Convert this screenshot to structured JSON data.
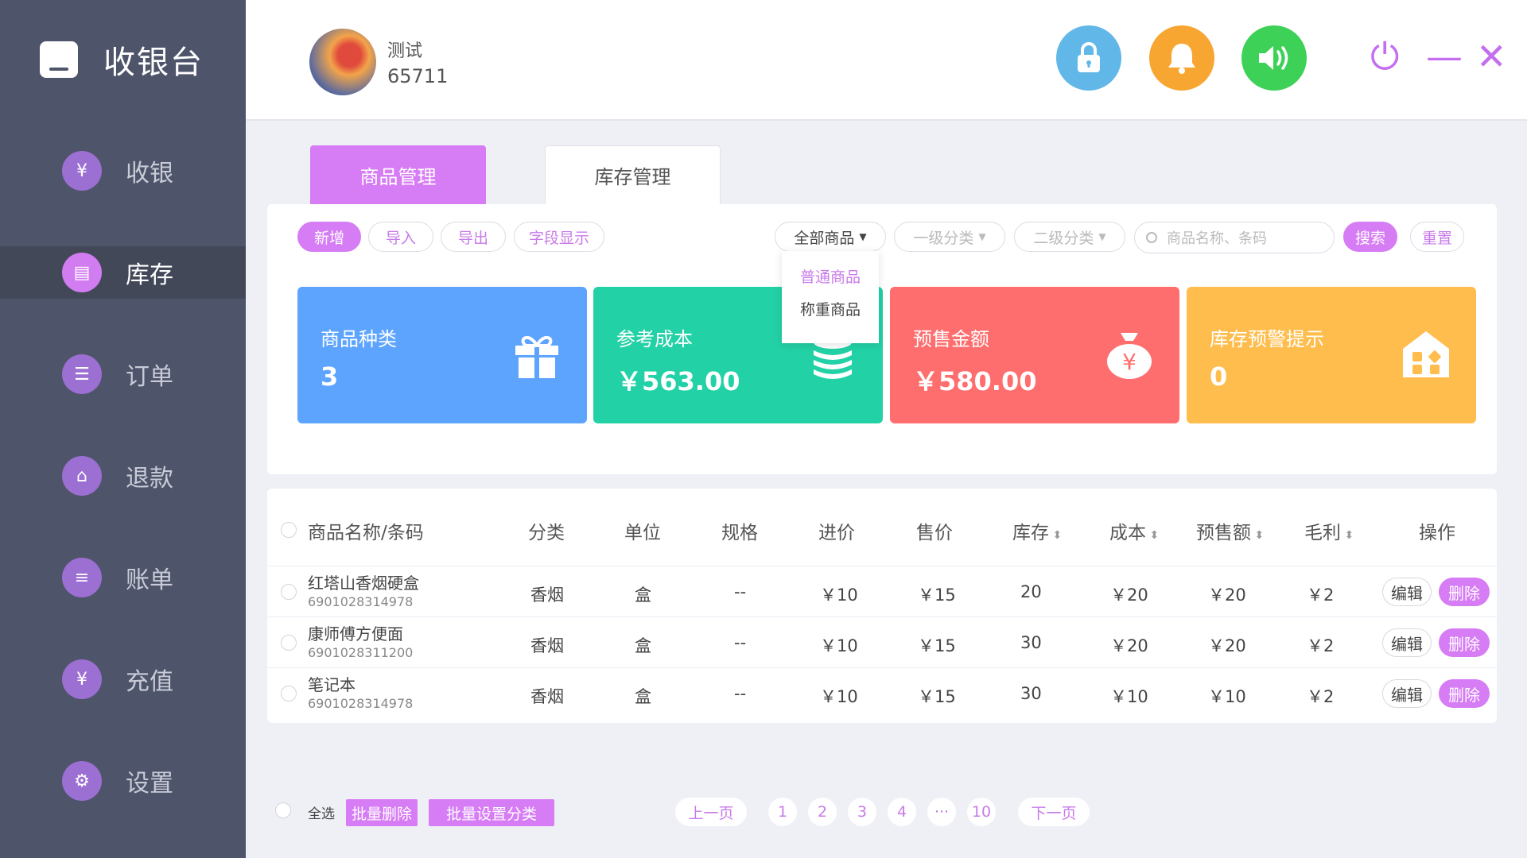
{
  "app": {
    "title": "收银台"
  },
  "sidebar": {
    "items": [
      {
        "label": "收银",
        "icon": "¥"
      },
      {
        "label": "库存",
        "icon": "▤"
      },
      {
        "label": "订单",
        "icon": "☰"
      },
      {
        "label": "退款",
        "icon": "⌂"
      },
      {
        "label": "账单",
        "icon": "≡"
      },
      {
        "label": "充值",
        "icon": "¥"
      },
      {
        "label": "设置",
        "icon": "⚙"
      }
    ],
    "active": "库存"
  },
  "header": {
    "user_name": "测试",
    "user_id": "65711",
    "lock_icon": "🔒",
    "bell_icon": "🔔",
    "sound_icon": "🔊",
    "power_icon": "⏻",
    "minimize_icon": "—",
    "close_icon": "✕"
  },
  "tabs": [
    {
      "label": "商品管理"
    },
    {
      "label": "库存管理"
    }
  ],
  "toolbar": {
    "add": "新增",
    "import": "导入",
    "export": "导出",
    "fields": "字段显示",
    "filter_all": "全部商品",
    "filter_cat1": "一级分类",
    "filter_cat2": "二级分类",
    "search_placeholder": "商品名称、条码",
    "search_btn": "搜索",
    "reset_btn": "重置"
  },
  "dropdown": {
    "options": [
      "普通商品",
      "称重商品"
    ]
  },
  "stats": [
    {
      "label": "商品种类",
      "value": "3",
      "icon": "gift-icon"
    },
    {
      "label": "参考成本",
      "value": "￥563.00",
      "icon": "coins-icon"
    },
    {
      "label": "预售金额",
      "value": "￥580.00",
      "icon": "money-bag-icon"
    },
    {
      "label": "库存预警提示",
      "value": "0",
      "icon": "warehouse-icon"
    }
  ],
  "table": {
    "headers": [
      "商品名称/条码",
      "分类",
      "单位",
      "规格",
      "进价",
      "售价",
      "库存",
      "成本",
      "预售额",
      "毛利",
      "操作"
    ],
    "rows": [
      {
        "name": "红塔山香烟硬盒",
        "code": "6901028314978",
        "category": "香烟",
        "unit": "盒",
        "spec": "--",
        "buy": "￥10",
        "sell": "￥15",
        "stock": "20",
        "cost": "￥20",
        "presale": "￥20",
        "profit": "￥2",
        "edit": "编辑",
        "delete": "删除"
      },
      {
        "name": "康师傅方便面",
        "code": "6901028311200",
        "category": "香烟",
        "unit": "盒",
        "spec": "--",
        "buy": "￥10",
        "sell": "￥15",
        "stock": "30",
        "cost": "￥20",
        "presale": "￥20",
        "profit": "￥2",
        "edit": "编辑",
        "delete": "删除"
      },
      {
        "name": "笔记本",
        "code": "6901028314978",
        "category": "香烟",
        "unit": "盒",
        "spec": "--",
        "buy": "￥10",
        "sell": "￥15",
        "stock": "30",
        "cost": "￥10",
        "presale": "￥10",
        "profit": "￥2",
        "edit": "编辑",
        "delete": "删除"
      }
    ]
  },
  "footer": {
    "select_all": "全选",
    "batch_delete": "批量删除",
    "batch_category": "批量设置分类",
    "prev": "上一页",
    "pages": [
      "1",
      "2",
      "3",
      "4",
      "···",
      "10"
    ],
    "next": "下一页"
  }
}
